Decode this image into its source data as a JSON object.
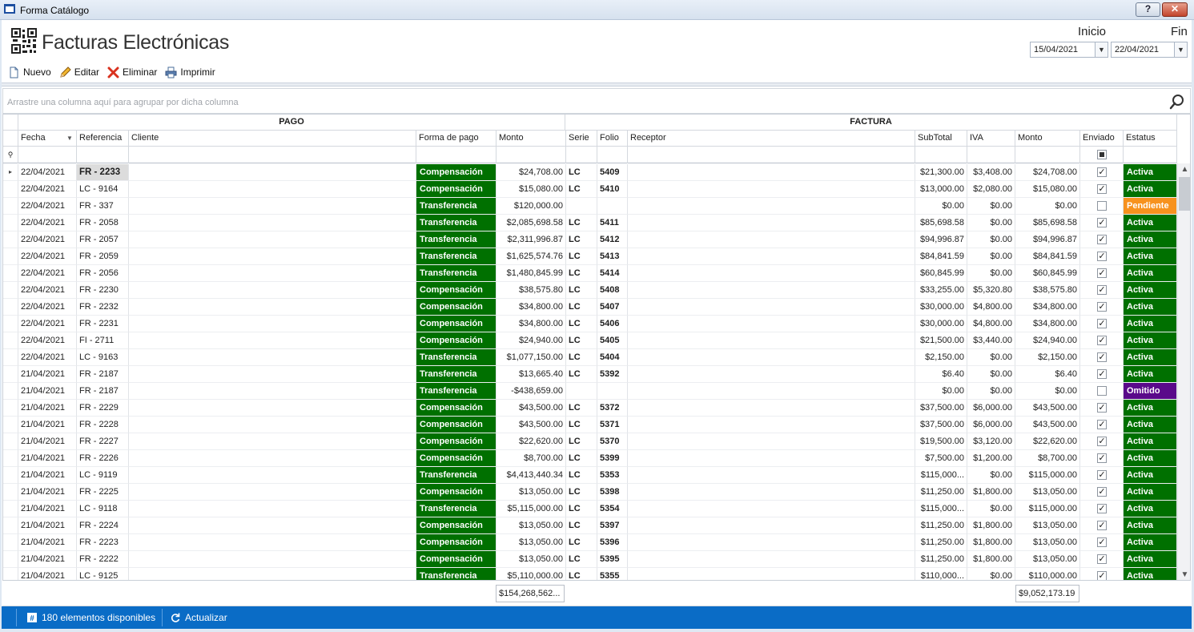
{
  "window": {
    "title": "Forma Catálogo",
    "help_label": "?",
    "close_label": "✕"
  },
  "header": {
    "title": "Facturas Electrónicas"
  },
  "toolbar": {
    "new_label": "Nuevo",
    "edit_label": "Editar",
    "delete_label": "Eliminar",
    "print_label": "Imprimir"
  },
  "dates": {
    "start_label": "Inicio",
    "end_label": "Fin",
    "start_value": "15/04/2021",
    "end_value": "22/04/2021"
  },
  "group_panel": {
    "hint": "Arrastre una columna aquí para agrupar por dicha columna"
  },
  "grid": {
    "bands": {
      "pago": "PAGO",
      "factura": "FACTURA"
    },
    "columns": {
      "fecha": "Fecha",
      "referencia": "Referencia",
      "cliente": "Cliente",
      "forma_pago": "Forma de pago",
      "monto_pago": "Monto",
      "serie": "Serie",
      "folio": "Folio",
      "receptor": "Receptor",
      "subtotal": "SubTotal",
      "iva": "IVA",
      "monto": "Monto",
      "enviado": "Enviado",
      "estatus": "Estatus"
    },
    "rows": [
      {
        "fecha": "22/04/2021",
        "ref": "FR - 2233",
        "forma": "Compensación",
        "monto_pago": "$24,708.00",
        "serie": "LC",
        "folio": "5409",
        "subtotal": "$21,300.00",
        "iva": "$3,408.00",
        "monto": "$24,708.00",
        "enviado": true,
        "estatus": "Activa"
      },
      {
        "fecha": "22/04/2021",
        "ref": "LC - 9164",
        "forma": "Compensación",
        "monto_pago": "$15,080.00",
        "serie": "LC",
        "folio": "5410",
        "subtotal": "$13,000.00",
        "iva": "$2,080.00",
        "monto": "$15,080.00",
        "enviado": true,
        "estatus": "Activa"
      },
      {
        "fecha": "22/04/2021",
        "ref": "FR - 337",
        "forma": "Transferencia",
        "monto_pago": "$120,000.00",
        "serie": "",
        "folio": "",
        "subtotal": "$0.00",
        "iva": "$0.00",
        "monto": "$0.00",
        "enviado": false,
        "estatus": "Pendiente"
      },
      {
        "fecha": "22/04/2021",
        "ref": "FR - 2058",
        "forma": "Transferencia",
        "monto_pago": "$2,085,698.58",
        "serie": "LC",
        "folio": "5411",
        "subtotal": "$85,698.58",
        "iva": "$0.00",
        "monto": "$85,698.58",
        "enviado": true,
        "estatus": "Activa"
      },
      {
        "fecha": "22/04/2021",
        "ref": "FR - 2057",
        "forma": "Transferencia",
        "monto_pago": "$2,311,996.87",
        "serie": "LC",
        "folio": "5412",
        "subtotal": "$94,996.87",
        "iva": "$0.00",
        "monto": "$94,996.87",
        "enviado": true,
        "estatus": "Activa"
      },
      {
        "fecha": "22/04/2021",
        "ref": "FR - 2059",
        "forma": "Transferencia",
        "monto_pago": "$1,625,574.76",
        "serie": "LC",
        "folio": "5413",
        "subtotal": "$84,841.59",
        "iva": "$0.00",
        "monto": "$84,841.59",
        "enviado": true,
        "estatus": "Activa"
      },
      {
        "fecha": "22/04/2021",
        "ref": "FR - 2056",
        "forma": "Transferencia",
        "monto_pago": "$1,480,845.99",
        "serie": "LC",
        "folio": "5414",
        "subtotal": "$60,845.99",
        "iva": "$0.00",
        "monto": "$60,845.99",
        "enviado": true,
        "estatus": "Activa"
      },
      {
        "fecha": "22/04/2021",
        "ref": "FR - 2230",
        "forma": "Compensación",
        "monto_pago": "$38,575.80",
        "serie": "LC",
        "folio": "5408",
        "subtotal": "$33,255.00",
        "iva": "$5,320.80",
        "monto": "$38,575.80",
        "enviado": true,
        "estatus": "Activa"
      },
      {
        "fecha": "22/04/2021",
        "ref": "FR - 2232",
        "forma": "Compensación",
        "monto_pago": "$34,800.00",
        "serie": "LC",
        "folio": "5407",
        "subtotal": "$30,000.00",
        "iva": "$4,800.00",
        "monto": "$34,800.00",
        "enviado": true,
        "estatus": "Activa"
      },
      {
        "fecha": "22/04/2021",
        "ref": "FR - 2231",
        "forma": "Compensación",
        "monto_pago": "$34,800.00",
        "serie": "LC",
        "folio": "5406",
        "subtotal": "$30,000.00",
        "iva": "$4,800.00",
        "monto": "$34,800.00",
        "enviado": true,
        "estatus": "Activa"
      },
      {
        "fecha": "22/04/2021",
        "ref": "FI - 2711",
        "forma": "Compensación",
        "monto_pago": "$24,940.00",
        "serie": "LC",
        "folio": "5405",
        "subtotal": "$21,500.00",
        "iva": "$3,440.00",
        "monto": "$24,940.00",
        "enviado": true,
        "estatus": "Activa"
      },
      {
        "fecha": "22/04/2021",
        "ref": "LC - 9163",
        "forma": "Transferencia",
        "monto_pago": "$1,077,150.00",
        "serie": "LC",
        "folio": "5404",
        "subtotal": "$2,150.00",
        "iva": "$0.00",
        "monto": "$2,150.00",
        "enviado": true,
        "estatus": "Activa"
      },
      {
        "fecha": "21/04/2021",
        "ref": "FR - 2187",
        "forma": "Transferencia",
        "monto_pago": "$13,665.40",
        "serie": "LC",
        "folio": "5392",
        "subtotal": "$6.40",
        "iva": "$0.00",
        "monto": "$6.40",
        "enviado": true,
        "estatus": "Activa"
      },
      {
        "fecha": "21/04/2021",
        "ref": "FR - 2187",
        "forma": "Transferencia",
        "monto_pago": "-$438,659.00",
        "serie": "",
        "folio": "",
        "subtotal": "$0.00",
        "iva": "$0.00",
        "monto": "$0.00",
        "enviado": false,
        "estatus": "Omitido"
      },
      {
        "fecha": "21/04/2021",
        "ref": "FR - 2229",
        "forma": "Compensación",
        "monto_pago": "$43,500.00",
        "serie": "LC",
        "folio": "5372",
        "subtotal": "$37,500.00",
        "iva": "$6,000.00",
        "monto": "$43,500.00",
        "enviado": true,
        "estatus": "Activa"
      },
      {
        "fecha": "21/04/2021",
        "ref": "FR - 2228",
        "forma": "Compensación",
        "monto_pago": "$43,500.00",
        "serie": "LC",
        "folio": "5371",
        "subtotal": "$37,500.00",
        "iva": "$6,000.00",
        "monto": "$43,500.00",
        "enviado": true,
        "estatus": "Activa"
      },
      {
        "fecha": "21/04/2021",
        "ref": "FR - 2227",
        "forma": "Compensación",
        "monto_pago": "$22,620.00",
        "serie": "LC",
        "folio": "5370",
        "subtotal": "$19,500.00",
        "iva": "$3,120.00",
        "monto": "$22,620.00",
        "enviado": true,
        "estatus": "Activa"
      },
      {
        "fecha": "21/04/2021",
        "ref": "FR - 2226",
        "forma": "Compensación",
        "monto_pago": "$8,700.00",
        "serie": "LC",
        "folio": "5399",
        "subtotal": "$7,500.00",
        "iva": "$1,200.00",
        "monto": "$8,700.00",
        "enviado": true,
        "estatus": "Activa"
      },
      {
        "fecha": "21/04/2021",
        "ref": "LC - 9119",
        "forma": "Transferencia",
        "monto_pago": "$4,413,440.34",
        "serie": "LC",
        "folio": "5353",
        "subtotal": "$115,000...",
        "iva": "$0.00",
        "monto": "$115,000.00",
        "enviado": true,
        "estatus": "Activa"
      },
      {
        "fecha": "21/04/2021",
        "ref": "FR - 2225",
        "forma": "Compensación",
        "monto_pago": "$13,050.00",
        "serie": "LC",
        "folio": "5398",
        "subtotal": "$11,250.00",
        "iva": "$1,800.00",
        "monto": "$13,050.00",
        "enviado": true,
        "estatus": "Activa"
      },
      {
        "fecha": "21/04/2021",
        "ref": "LC - 9118",
        "forma": "Transferencia",
        "monto_pago": "$5,115,000.00",
        "serie": "LC",
        "folio": "5354",
        "subtotal": "$115,000...",
        "iva": "$0.00",
        "monto": "$115,000.00",
        "enviado": true,
        "estatus": "Activa"
      },
      {
        "fecha": "21/04/2021",
        "ref": "FR - 2224",
        "forma": "Compensación",
        "monto_pago": "$13,050.00",
        "serie": "LC",
        "folio": "5397",
        "subtotal": "$11,250.00",
        "iva": "$1,800.00",
        "monto": "$13,050.00",
        "enviado": true,
        "estatus": "Activa"
      },
      {
        "fecha": "21/04/2021",
        "ref": "FR - 2223",
        "forma": "Compensación",
        "monto_pago": "$13,050.00",
        "serie": "LC",
        "folio": "5396",
        "subtotal": "$11,250.00",
        "iva": "$1,800.00",
        "monto": "$13,050.00",
        "enviado": true,
        "estatus": "Activa"
      },
      {
        "fecha": "21/04/2021",
        "ref": "FR - 2222",
        "forma": "Compensación",
        "monto_pago": "$13,050.00",
        "serie": "LC",
        "folio": "5395",
        "subtotal": "$11,250.00",
        "iva": "$1,800.00",
        "monto": "$13,050.00",
        "enviado": true,
        "estatus": "Activa"
      },
      {
        "fecha": "21/04/2021",
        "ref": "LC - 9125",
        "forma": "Transferencia",
        "monto_pago": "$5,110,000.00",
        "serie": "LC",
        "folio": "5355",
        "subtotal": "$110,000...",
        "iva": "$0.00",
        "monto": "$110,000.00",
        "enviado": true,
        "estatus": "Activa"
      }
    ],
    "totals": {
      "monto_pago": "$154,268,562...",
      "monto": "$9,052,173.19"
    }
  },
  "statusbar": {
    "count_label": "180 elementos disponibles",
    "refresh_label": "Actualizar"
  },
  "colors": {
    "payment_green": "#007000",
    "status_active": "#007000",
    "status_pending": "#f7921e",
    "status_omitted": "#5a0a8a",
    "statusbar_blue": "#0a6cc6"
  }
}
